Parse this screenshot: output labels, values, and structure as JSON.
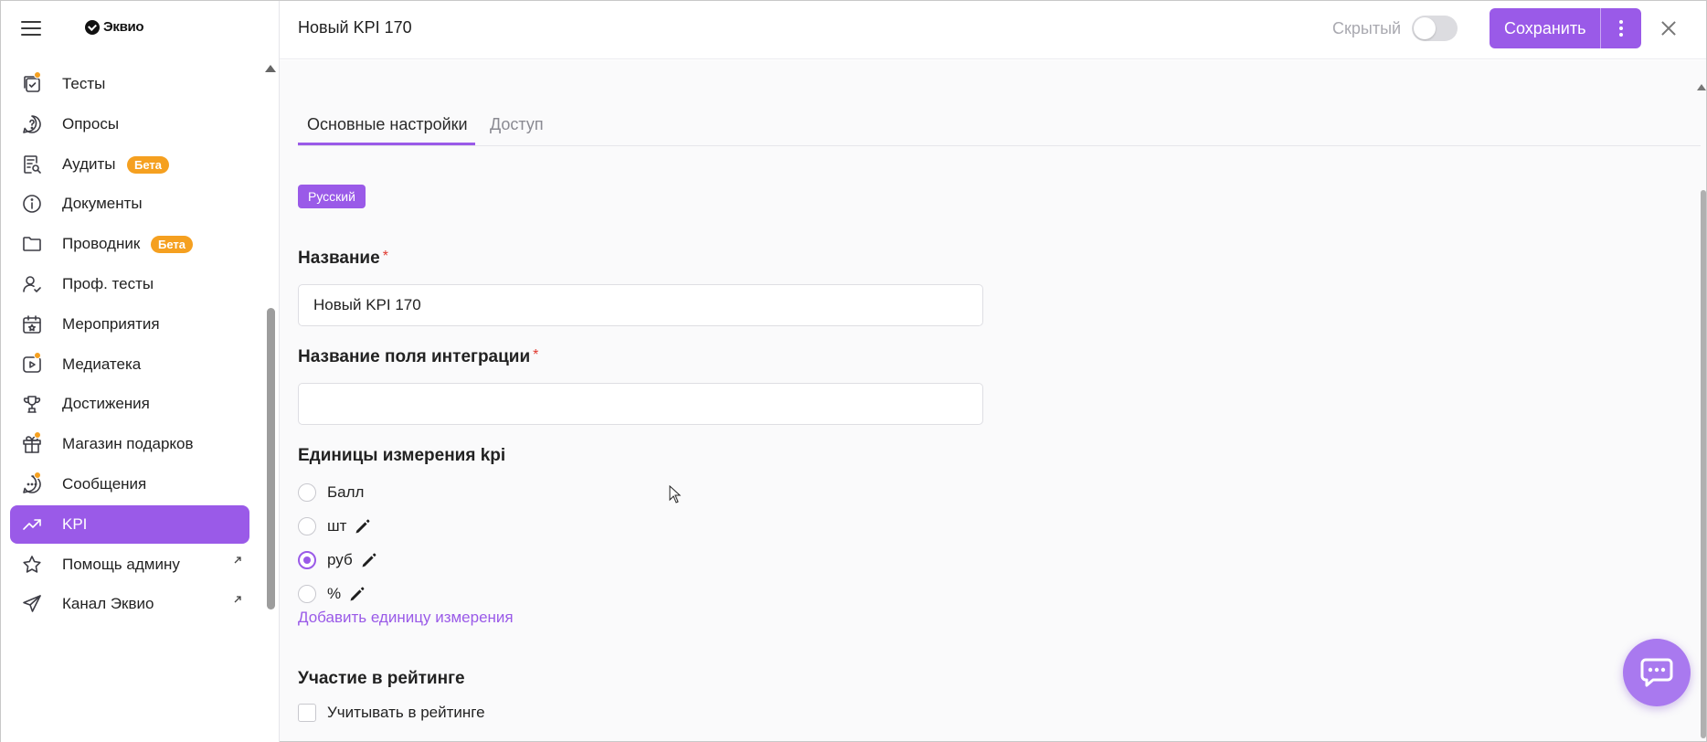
{
  "app": {
    "logo_text": "Эквио",
    "page_title": "Новый KPI 170"
  },
  "sidebar": {
    "items": [
      {
        "label": "Тесты",
        "icon": "tests-icon",
        "dot": true
      },
      {
        "label": "Опросы",
        "icon": "survey-icon"
      },
      {
        "label": "Аудиты",
        "icon": "audit-icon",
        "badge": "Бета"
      },
      {
        "label": "Документы",
        "icon": "info-icon"
      },
      {
        "label": "Проводник",
        "icon": "folder-icon",
        "badge": "Бета"
      },
      {
        "label": "Проф. тесты",
        "icon": "user-check-icon"
      },
      {
        "label": "Мероприятия",
        "icon": "calendar-icon"
      },
      {
        "label": "Медиатека",
        "icon": "media-icon",
        "dot": true
      },
      {
        "label": "Достижения",
        "icon": "trophy-icon"
      },
      {
        "label": "Магазин подарков",
        "icon": "gift-icon",
        "dot": true
      },
      {
        "label": "Сообщения",
        "icon": "messages-icon",
        "dot": true
      },
      {
        "label": "KPI",
        "icon": "trending-up-icon",
        "active": true
      },
      {
        "label": "Помощь админу",
        "icon": "star-icon",
        "external": true
      },
      {
        "label": "Канал Эквио",
        "icon": "send-icon",
        "external": true
      }
    ]
  },
  "header": {
    "hidden_label": "Скрытый",
    "hidden_toggle_on": false,
    "save_label": "Сохранить"
  },
  "tabs": [
    {
      "label": "Основные настройки",
      "active": true
    },
    {
      "label": "Доступ",
      "active": false
    }
  ],
  "form": {
    "language_chip": "Русский",
    "name_label": "Название",
    "name_value": "Новый KPI 170",
    "integration_label": "Название поля интеграции",
    "integration_value": "",
    "units_label": "Единицы измерения kpi",
    "units": [
      {
        "label": "Балл",
        "checked": false,
        "editable": false
      },
      {
        "label": "шт",
        "checked": false,
        "editable": true
      },
      {
        "label": "руб",
        "checked": true,
        "editable": true
      },
      {
        "label": "%",
        "checked": false,
        "editable": true
      }
    ],
    "add_unit_link": "Добавить единицу измерения",
    "rating_label": "Участие в рейтинге",
    "rating_checkbox_label": "Учитывать в рейтинге",
    "rating_checked": false,
    "required_mark": "*"
  },
  "colors": {
    "accent": "#9a5ae8",
    "badge": "#f5a020",
    "required": "#e0392f"
  }
}
